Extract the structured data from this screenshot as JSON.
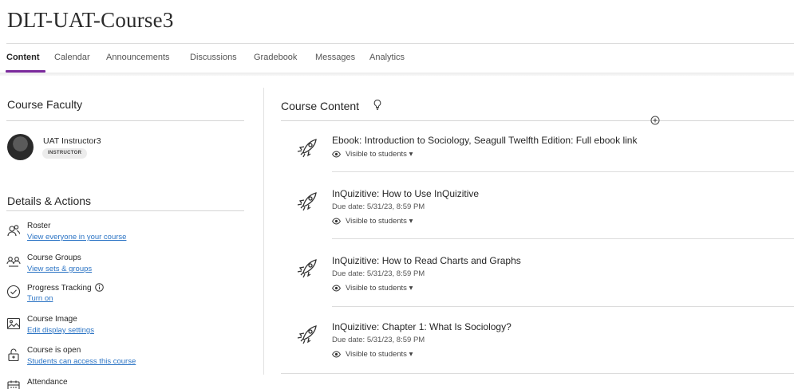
{
  "course": {
    "title": "DLT-UAT-Course3"
  },
  "nav": {
    "tabs": [
      {
        "label": "Content",
        "active": true
      },
      {
        "label": "Calendar"
      },
      {
        "label": "Announcements"
      },
      {
        "label": "Discussions"
      },
      {
        "label": "Gradebook"
      },
      {
        "label": "Messages"
      },
      {
        "label": "Analytics"
      }
    ],
    "accent_color": "#7b2a9c"
  },
  "sidebar": {
    "faculty_heading": "Course Faculty",
    "faculty": {
      "name": "UAT Instructor3",
      "role": "INSTRUCTOR"
    },
    "details_heading": "Details & Actions",
    "actions": [
      {
        "icon": "roster-icon",
        "title": "Roster",
        "link": "View everyone in your course"
      },
      {
        "icon": "groups-icon",
        "title": "Course Groups",
        "link": "View sets & groups"
      },
      {
        "icon": "progress-check-icon",
        "title": "Progress Tracking",
        "link": "Turn on",
        "has_info": true
      },
      {
        "icon": "image-icon",
        "title": "Course Image",
        "link": "Edit display settings"
      },
      {
        "icon": "unlock-icon",
        "title": "Course is open",
        "link": "Students can access this course"
      },
      {
        "icon": "calendar-icon",
        "title": "Attendance",
        "link": ""
      }
    ],
    "link_color": "#2a73c4"
  },
  "content": {
    "heading": "Course Content",
    "items": [
      {
        "title": "Ebook: Introduction to Sociology, Seagull Twelfth Edition: Full ebook link",
        "due": "",
        "visibility": "Visible to students"
      },
      {
        "title": "InQuizitive: How to Use InQuizitive",
        "due": "Due date: 5/31/23, 8:59 PM",
        "visibility": "Visible to students"
      },
      {
        "title": "InQuizitive: How to Read Charts and Graphs",
        "due": "Due date: 5/31/23, 8:59 PM",
        "visibility": "Visible to students"
      },
      {
        "title": "InQuizitive: Chapter 1: What Is Sociology?",
        "due": "Due date: 5/31/23, 8:59 PM",
        "visibility": "Visible to students"
      }
    ]
  }
}
